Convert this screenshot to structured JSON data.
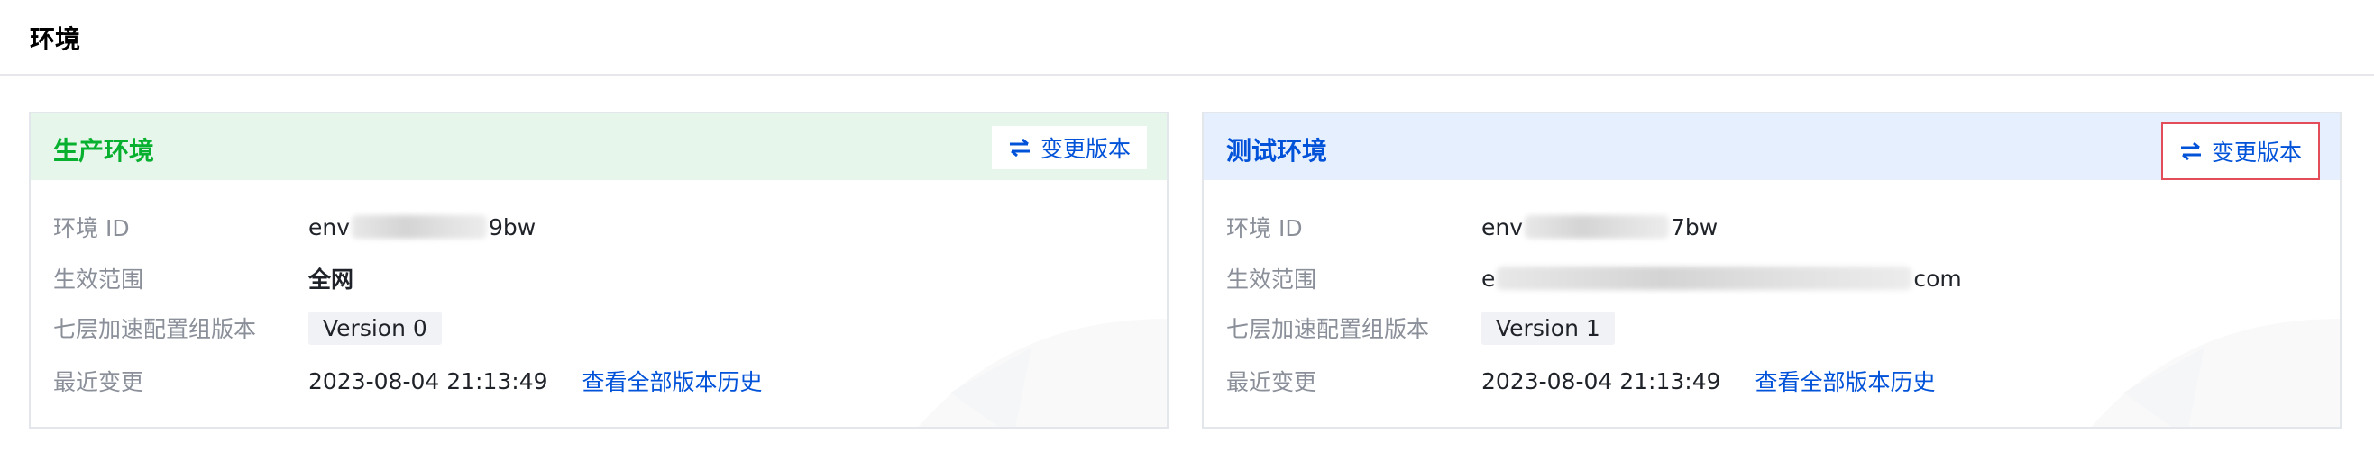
{
  "page": {
    "title": "环境"
  },
  "colors": {
    "prod_accent": "#07b12f",
    "test_accent": "#0052d9",
    "link": "#0052d9",
    "highlight_border": "#e34d59"
  },
  "production": {
    "title": "生产环境",
    "change_button": "变更版本",
    "env_id_label": "环境 ID",
    "env_id_prefix": "env",
    "env_id_suffix": "9bw",
    "scope_label": "生效范围",
    "scope_value": "全网",
    "config_label": "七层加速配置组版本",
    "config_value": "Version 0",
    "last_change_label": "最近变更",
    "last_change_value": "2023-08-04 21:13:49",
    "history_link": "查看全部版本历史"
  },
  "testing": {
    "title": "测试环境",
    "change_button": "变更版本",
    "env_id_label": "环境 ID",
    "env_id_prefix": "env",
    "env_id_suffix": "7bw",
    "scope_label": "生效范围",
    "scope_prefix": "e",
    "scope_suffix": "com",
    "config_label": "七层加速配置组版本",
    "config_value": "Version 1",
    "last_change_label": "最近变更",
    "last_change_value": "2023-08-04 21:13:49",
    "history_link": "查看全部版本历史"
  }
}
